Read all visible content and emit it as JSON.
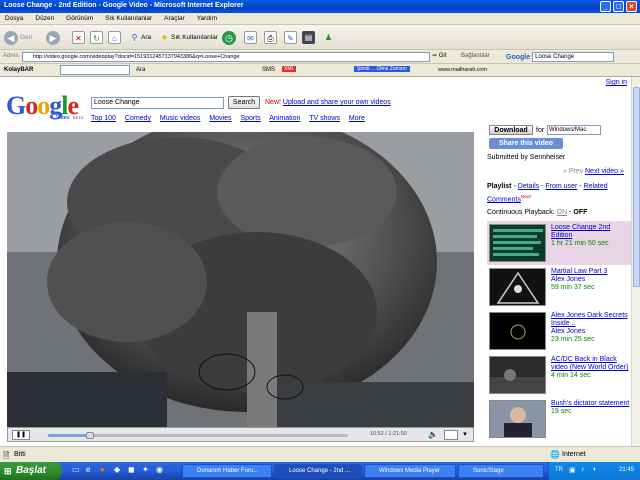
{
  "window": {
    "title": "Loose Change - 2nd Edition - Google Video - Microsoft Internet Explorer"
  },
  "menu": [
    "Dosya",
    "Düzen",
    "Görünüm",
    "Sık Kullanılanlar",
    "Araçlar",
    "Yardım"
  ],
  "toolbar": {
    "back": "Geri",
    "favorites": "Sık Kullanılanlar"
  },
  "address": {
    "label": "Adres",
    "url": "http://video.google.com/videoplay?docid=1519312457137943386&q=Loose+Change",
    "go": "Git",
    "links": "Bağlantılar",
    "google_search_value": "Loose Change",
    "google_label": "Google",
    "ara": "Ara"
  },
  "kolaybar": {
    "name": "KolayBAR",
    "ara": "Ara",
    "sms": "SMS",
    "promo": "Şimdi ... Olma Zamanı",
    "site": "www.mailharati.com"
  },
  "page": {
    "sign_in": "Sign in",
    "logo_sub": "Video",
    "logo_beta": "BETA",
    "search_value": "Loose Change",
    "search_button": "Search",
    "new_label": "New!",
    "upload_link": "Upload and share your own videos",
    "categories": [
      "Top 100",
      "Comedy",
      "Music videos",
      "Movies",
      "Sports",
      "Animation",
      "TV shows",
      "More"
    ]
  },
  "player": {
    "time": "10:52 / 1:21:50"
  },
  "panel": {
    "download_button": "Download",
    "for_label": "for",
    "platform_select": "Windows/Mac",
    "share_button": "Share this video",
    "submitted_by": "Submitted by Sennheiser",
    "prev": "« Prev",
    "next": "Next video »",
    "playlist_label": "Playlist",
    "playlist_links": [
      "Details",
      "From user",
      "Related"
    ],
    "comments": "Comments",
    "comments_new": "New!",
    "continuous_label": "Continuous Playback:",
    "continuous_on": "ON",
    "continuous_off": "OFF",
    "videos": [
      {
        "title": "Loose Change 2nd Edition",
        "meta": "1 hr 21 min 50 sec",
        "author": ""
      },
      {
        "title": "Martial Law Part 3",
        "meta": "59 min 37 sec",
        "author": "Alex Jones"
      },
      {
        "title": "Alex Jones Dark Secrets Inside ..",
        "meta": "23 min 25 sec",
        "author": "Alex Jones"
      },
      {
        "title": "AC/DC Back in Black video (New World Order)",
        "meta": "4 min 14 sec",
        "author": ""
      },
      {
        "title": "Bush's dictator statement",
        "meta": "19 sec",
        "author": ""
      }
    ]
  },
  "status": {
    "done": "Bitti",
    "zone": "Internet"
  },
  "taskbar": {
    "start": "Başlat",
    "tasks": [
      "Donanım Haber Foru...",
      "Loose Change - 2nd ...",
      "Windows Media Player",
      "SonicStage"
    ],
    "lang": "TR",
    "clock": "21:45"
  }
}
